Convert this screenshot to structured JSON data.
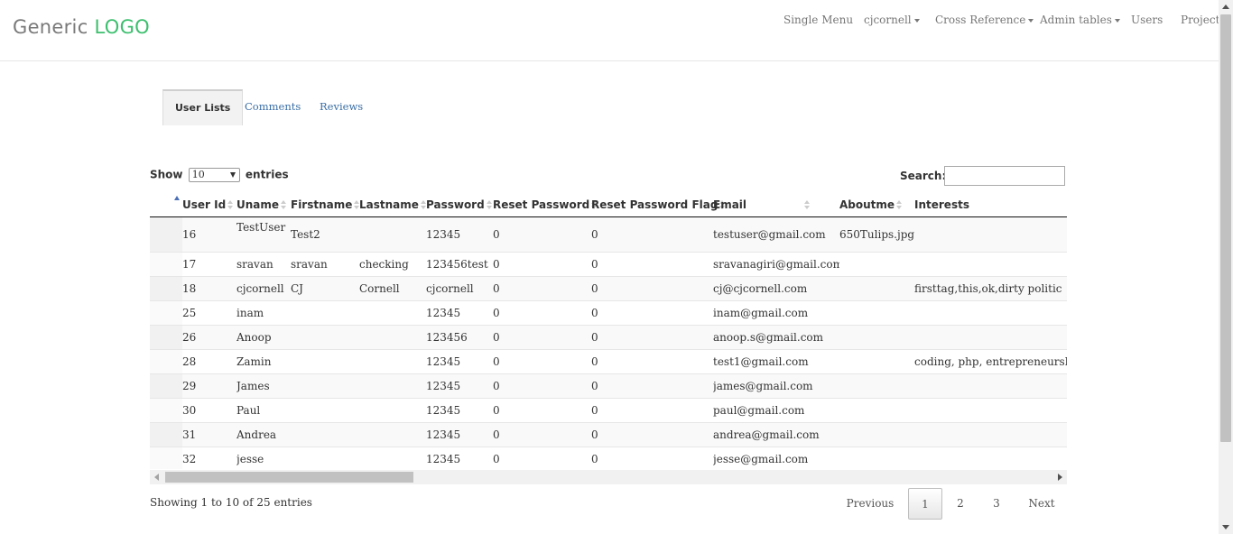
{
  "navbar": {
    "logo_text": "Generic ",
    "logo_accent": "LOGO",
    "items": [
      {
        "label": "Single Menu",
        "dropdown": false
      },
      {
        "label": "cjcornell",
        "dropdown": true
      },
      {
        "label": "Cross Reference",
        "dropdown": true
      },
      {
        "label": "Admin tables",
        "dropdown": true
      },
      {
        "label": "Users",
        "dropdown": false
      },
      {
        "label": "Projects",
        "dropdown": false
      }
    ]
  },
  "tabs": [
    {
      "label": "User Lists",
      "active": true
    },
    {
      "label": "Comments",
      "active": false
    },
    {
      "label": "Reviews",
      "active": false
    }
  ],
  "controls": {
    "show_label": "Show",
    "entries_value": "10",
    "entries_label": "entries",
    "search_label": "Search:",
    "search_value": ""
  },
  "table": {
    "columns": [
      "",
      "User Id",
      "Uname",
      "Firstname",
      "Lastname",
      "Password",
      "Reset Password",
      "Reset Password Flag",
      "Email",
      "Aboutme",
      "Interests"
    ],
    "rows": [
      [
        "16",
        "TestUser",
        "Test2",
        "",
        "12345",
        "0",
        "0",
        "testuser@gmail.com",
        "650Tulips.jpg",
        ""
      ],
      [
        "17",
        "sravan",
        "sravan",
        "checking",
        "123456test",
        "0",
        "0",
        "sravanagiri@gmail.com",
        "",
        ""
      ],
      [
        "18",
        "cjcornell",
        "CJ",
        "Cornell",
        "cjcornell",
        "0",
        "0",
        "cj@cjcornell.com",
        "",
        "firsttag,this,ok,dirty politic"
      ],
      [
        "25",
        "inam",
        "",
        "",
        "12345",
        "0",
        "0",
        "inam@gmail.com",
        "",
        ""
      ],
      [
        "26",
        "Anoop",
        "",
        "",
        "123456",
        "0",
        "0",
        "anoop.s@gmail.com",
        "",
        ""
      ],
      [
        "28",
        "Zamin",
        "",
        "",
        "12345",
        "0",
        "0",
        "test1@gmail.com",
        "",
        "coding, php, entrepreneurship"
      ],
      [
        "29",
        "James",
        "",
        "",
        "12345",
        "0",
        "0",
        "james@gmail.com",
        "",
        ""
      ],
      [
        "30",
        "Paul",
        "",
        "",
        "12345",
        "0",
        "0",
        "paul@gmail.com",
        "",
        ""
      ],
      [
        "31",
        "Andrea",
        "",
        "",
        "12345",
        "0",
        "0",
        "andrea@gmail.com",
        "",
        ""
      ],
      [
        "32",
        "jesse",
        "",
        "",
        "12345",
        "0",
        "0",
        "jesse@gmail.com",
        "",
        ""
      ]
    ]
  },
  "footer": {
    "info": "Showing 1 to 10 of 25 entries",
    "previous": "Previous",
    "pages": [
      "1",
      "2",
      "3"
    ],
    "current_page": "1",
    "next": "Next"
  }
}
